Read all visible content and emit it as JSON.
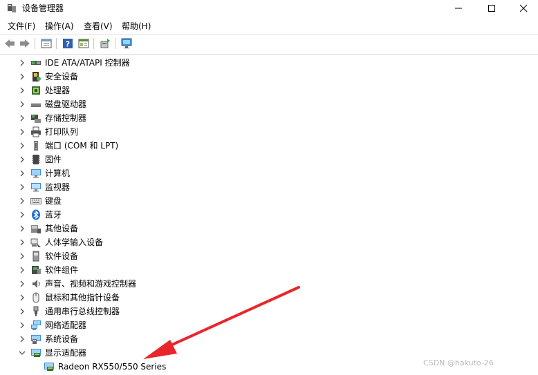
{
  "window": {
    "title": "设备管理器",
    "controls": {
      "minimize": "minimize",
      "maximize": "maximize",
      "close": "close"
    }
  },
  "menu": [
    {
      "label": "文件(F)"
    },
    {
      "label": "操作(A)"
    },
    {
      "label": "查看(V)"
    },
    {
      "label": "帮助(H)"
    }
  ],
  "toolbar": [
    "back-icon",
    "forward-icon",
    "properties-icon",
    "help-icon",
    "view-icon",
    "update-driver-icon",
    "scan-hardware-icon"
  ],
  "tree": {
    "items": [
      {
        "label": "IDE ATA/ATAPI 控制器",
        "icon": "ide-controller-icon",
        "expanded": false
      },
      {
        "label": "安全设备",
        "icon": "security-device-icon",
        "expanded": false
      },
      {
        "label": "处理器",
        "icon": "processor-icon",
        "expanded": false
      },
      {
        "label": "磁盘驱动器",
        "icon": "disk-drive-icon",
        "expanded": false
      },
      {
        "label": "存储控制器",
        "icon": "storage-controller-icon",
        "expanded": false
      },
      {
        "label": "打印队列",
        "icon": "printer-icon",
        "expanded": false
      },
      {
        "label": "端口 (COM 和 LPT)",
        "icon": "port-icon",
        "expanded": false
      },
      {
        "label": "固件",
        "icon": "firmware-icon",
        "expanded": false
      },
      {
        "label": "计算机",
        "icon": "computer-icon",
        "expanded": false
      },
      {
        "label": "监视器",
        "icon": "monitor-icon",
        "expanded": false
      },
      {
        "label": "键盘",
        "icon": "keyboard-icon",
        "expanded": false
      },
      {
        "label": "蓝牙",
        "icon": "bluetooth-icon",
        "expanded": false
      },
      {
        "label": "其他设备",
        "icon": "other-devices-icon",
        "expanded": false
      },
      {
        "label": "人体学输入设备",
        "icon": "hid-icon",
        "expanded": false
      },
      {
        "label": "软件设备",
        "icon": "software-device-icon",
        "expanded": false
      },
      {
        "label": "软件组件",
        "icon": "software-component-icon",
        "expanded": false
      },
      {
        "label": "声音、视频和游戏控制器",
        "icon": "sound-icon",
        "expanded": false
      },
      {
        "label": "鼠标和其他指针设备",
        "icon": "mouse-icon",
        "expanded": false
      },
      {
        "label": "通用串行总线控制器",
        "icon": "usb-icon",
        "expanded": false
      },
      {
        "label": "网络适配器",
        "icon": "network-adapter-icon",
        "expanded": false
      },
      {
        "label": "系统设备",
        "icon": "system-device-icon",
        "expanded": false
      },
      {
        "label": "显示适配器",
        "icon": "display-adapter-icon",
        "expanded": true
      }
    ],
    "child": {
      "label": "Radeon RX550/550 Series",
      "icon": "display-adapter-icon"
    }
  },
  "colors": {
    "annotation_arrow": "#e8262b",
    "monitor": "#3a8fd8"
  },
  "watermark": "CSDN @hakuto-26"
}
